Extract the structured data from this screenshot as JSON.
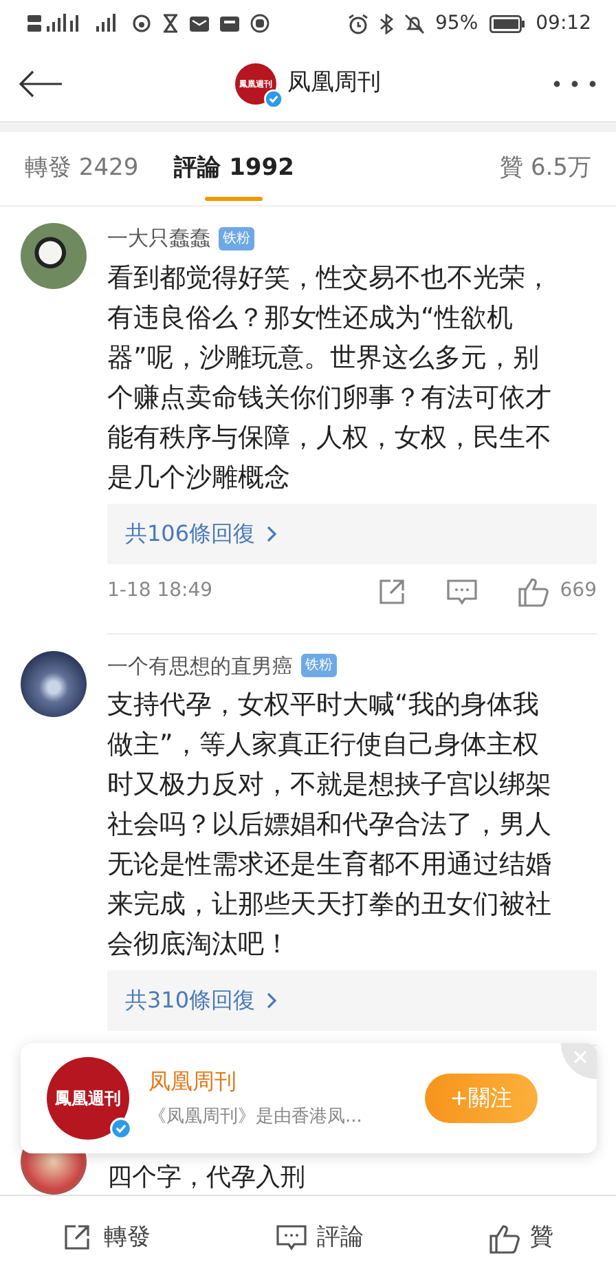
{
  "status_bar": {
    "battery": "95%",
    "time": "09:12"
  },
  "header": {
    "title": "凤凰周刊",
    "logo_text": "鳳凰週刊"
  },
  "tabs": [
    {
      "label": "轉發 2429",
      "selected": false
    },
    {
      "label": "評論 1992",
      "selected": true
    },
    {
      "label": "贊 6.5万",
      "selected": false
    }
  ],
  "comments": [
    {
      "user": "一大只蠢蠢",
      "badge": "铁粉",
      "text": "看到都觉得好笑，性交易不也不光荣，有违良俗么？那女性还成为“性欲机器”呢，沙雕玩意。世界这么多元，别个赚点卖命钱关你们卵事？有法可依才能有秩序与保障，人权，女权，民生不是几个沙雕概念",
      "replies": "共106條回復",
      "time": "1-18 18:49",
      "likes": "669"
    },
    {
      "user": "一个有思想的直男癌",
      "badge": "铁粉",
      "text": "支持代孕，女权平时大喊“我的身体我做主”，等人家真正行使自己身体主权时又极力反对，不就是想挟子宫以绑架社会吗？以后嫖娼和代孕合法了，男人无论是性需求还是生育都不用通过结婚来完成，让那些天天打拳的丑女们被社会彻底淘汰吧！",
      "replies": "共310條回復"
    }
  ],
  "partial_comment": {
    "text": "四个字，代孕入刑"
  },
  "follow_banner": {
    "logo_text": "鳳凰週刊",
    "name": "凤凰周刊",
    "description": "《凤凰周刊》是由香港凤...",
    "button": "+關注"
  },
  "bottom_bar": [
    {
      "label": "轉發"
    },
    {
      "label": "評論"
    },
    {
      "label": "贊"
    }
  ]
}
